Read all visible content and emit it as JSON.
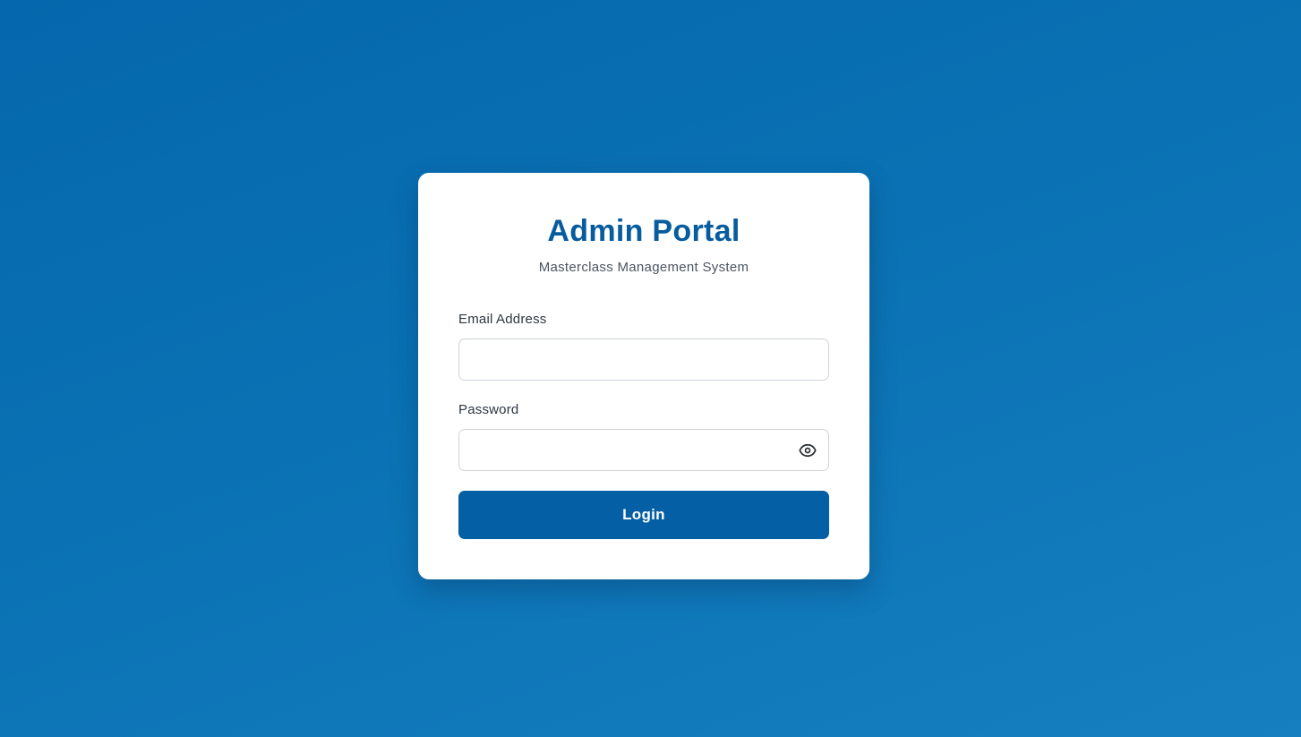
{
  "login_card": {
    "title": "Admin Portal",
    "subtitle": "Masterclass Management System",
    "email": {
      "label": "Email Address",
      "value": "",
      "placeholder": ""
    },
    "password": {
      "label": "Password",
      "value": "",
      "placeholder": "",
      "toggle_icon": "eye-icon"
    },
    "login_button_label": "Login"
  },
  "colors": {
    "background_start": "#0567ad",
    "background_end": "#157fbf",
    "title": "#065c9e",
    "button": "#055fa4",
    "card": "#ffffff"
  }
}
